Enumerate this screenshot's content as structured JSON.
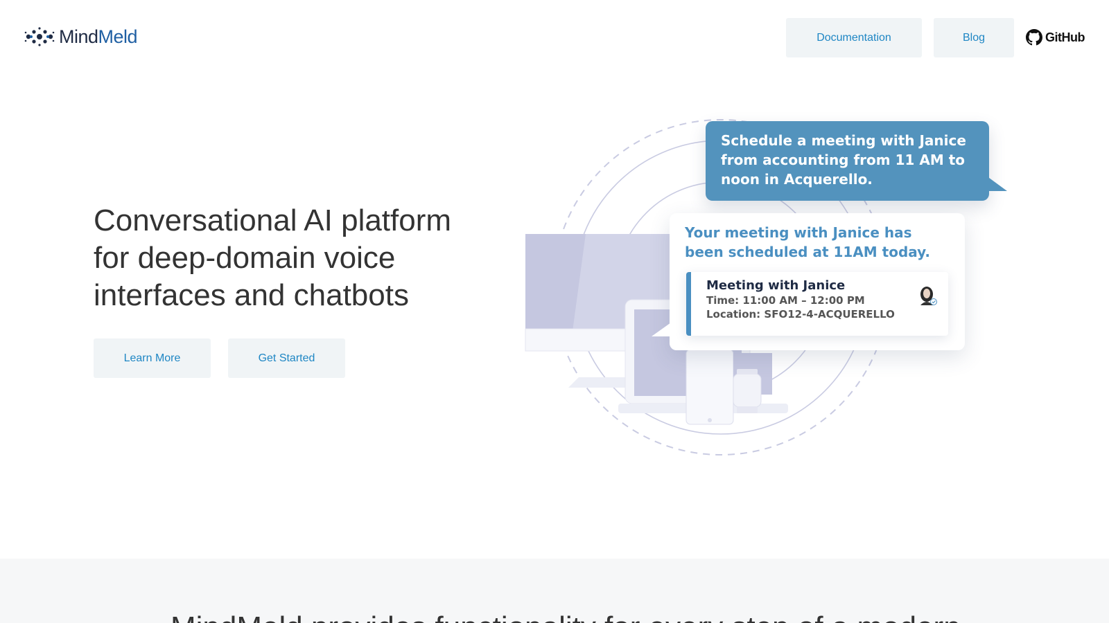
{
  "header": {
    "logo": {
      "mind": "Mind",
      "meld": "Meld",
      "icon": "mindmeld-logo-icon"
    },
    "nav": {
      "documentation": "Documentation",
      "blog": "Blog",
      "github": "GitHub"
    }
  },
  "hero": {
    "title_lines": [
      "Conversational AI platform",
      "for deep-domain voice",
      "interfaces and chatbots"
    ],
    "learn_more": "Learn More",
    "get_started": "Get Started"
  },
  "illustration": {
    "user_message": "Schedule a meeting with Janice from accounting from 11 AM to noon in Acquerello.",
    "bot_reply": "Your meeting with Janice has been scheduled at 11AM today.",
    "meeting": {
      "title": "Meeting with Janice",
      "time": "Time: 11:00 AM – 12:00 PM",
      "location": "Location: SFO12-4-ACQUERELLO"
    }
  },
  "next_section": {
    "heading_partial": "MindMeld provides functionality for every step of a modern"
  },
  "colors": {
    "accent": "#1e86c4",
    "button_bg": "#f0f4f6",
    "user_bubble": "#5393bd",
    "bot_text": "#4a8fc1",
    "device": "#c5c7e0",
    "band_bg": "#f6f7f8"
  }
}
